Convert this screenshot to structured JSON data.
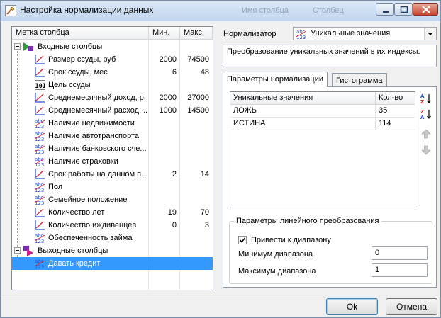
{
  "window": {
    "title": "Настройка нормализации данных",
    "ghost_labels": [
      "Имя столбца",
      "Столбец"
    ]
  },
  "tree": {
    "headers": {
      "label": "Метка столбца",
      "min": "Мин.",
      "max": "Макс."
    },
    "groups": {
      "inputs": "Входные столбцы",
      "outputs": "Выходные столбцы"
    },
    "rows": [
      {
        "label": "Размер ссуды, руб",
        "icon": "line-chart-icon",
        "min": "2000",
        "max": "74500"
      },
      {
        "label": "Срок ссуды, мес",
        "icon": "line-chart-icon",
        "min": "6",
        "max": "48"
      },
      {
        "label": "Цель ссуды",
        "icon": "binary-icon",
        "min": "",
        "max": ""
      },
      {
        "label": "Среднемесячный доход, р...",
        "icon": "line-chart-icon",
        "min": "2000",
        "max": "27000"
      },
      {
        "label": "Среднемесячный расход, ...",
        "icon": "line-chart-icon",
        "min": "1000",
        "max": "14500"
      },
      {
        "label": "Наличие недвижимости",
        "icon": "abc-123-icon",
        "min": "",
        "max": ""
      },
      {
        "label": "Наличие автотранспорта",
        "icon": "abc-123-icon",
        "min": "",
        "max": ""
      },
      {
        "label": "Наличие банковского сче...",
        "icon": "abc-123-icon",
        "min": "",
        "max": ""
      },
      {
        "label": "Наличие страховки",
        "icon": "abc-123-icon",
        "min": "",
        "max": ""
      },
      {
        "label": "Срок работы на данном п...",
        "icon": "line-chart-icon",
        "min": "2",
        "max": "14"
      },
      {
        "label": "Пол",
        "icon": "abc-123-icon",
        "min": "",
        "max": ""
      },
      {
        "label": "Семейное положение",
        "icon": "abc-123-icon",
        "min": "",
        "max": ""
      },
      {
        "label": "Количество лет",
        "icon": "line-chart-icon",
        "min": "19",
        "max": "70"
      },
      {
        "label": "Количество иждивенцев",
        "icon": "line-chart-icon",
        "min": "0",
        "max": "3"
      },
      {
        "label": "Обеспеченность займа",
        "icon": "abc-123-icon",
        "min": "",
        "max": ""
      }
    ],
    "output_rows": [
      {
        "label": "Давать кредит",
        "icon": "abc-123-icon",
        "min": "",
        "max": ""
      }
    ]
  },
  "normalizer": {
    "label": "Нормализатор",
    "selected": "Уникальные значения",
    "description": "Преобразование уникальных значений в их индексы."
  },
  "tabs": [
    {
      "label": "Параметры нормализации",
      "active": true
    },
    {
      "label": "Гистограмма",
      "active": false
    }
  ],
  "values_table": {
    "headers": {
      "value": "Уникальные значения",
      "count": "Кол-во"
    },
    "rows": [
      {
        "value": "ЛОЖЬ",
        "count": "35"
      },
      {
        "value": "ИСТИНА",
        "count": "114"
      }
    ]
  },
  "linear": {
    "title": "Параметры линейного преобразования",
    "fit_label": "Привести к диапазону",
    "fit_checked": true,
    "min_label": "Минимум диапазона",
    "min_value": "0",
    "max_label": "Максимум диапазона",
    "max_value": "1"
  },
  "buttons": {
    "ok": "Ok",
    "cancel": "Отмена"
  },
  "colors": {
    "selection": "#3399ff",
    "icon_blue": "#2b4fd8",
    "icon_red": "#e0212b"
  }
}
